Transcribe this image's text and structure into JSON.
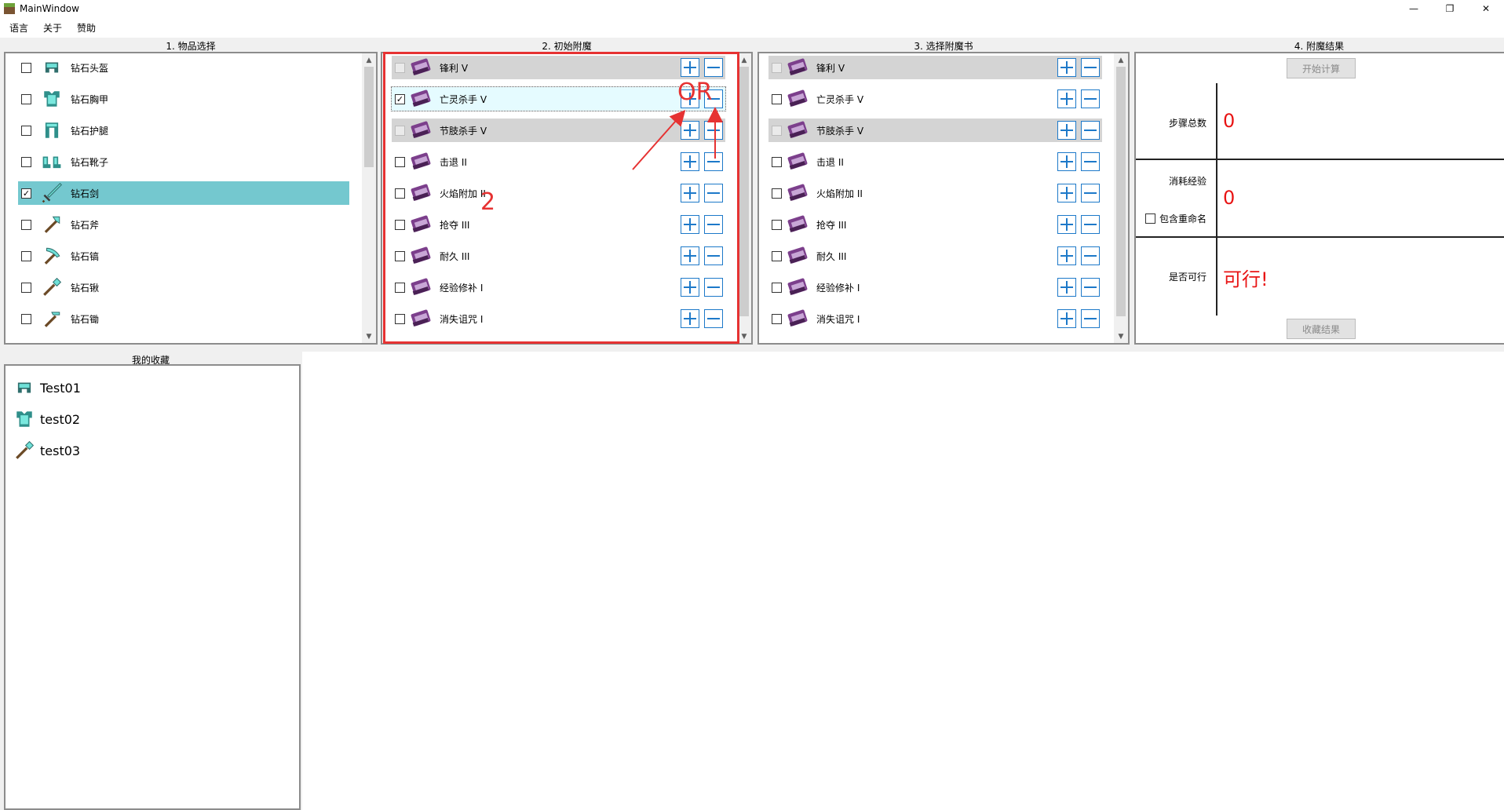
{
  "window": {
    "title": "MainWindow",
    "minimize": "—",
    "maximize": "❐",
    "close": "✕"
  },
  "menu": [
    "语言",
    "关于",
    "赞助"
  ],
  "groups": {
    "items": "1. 物品选择",
    "initial": "2. 初始附魔",
    "books": "3. 选择附魔书",
    "result": "4. 附魔结果"
  },
  "items": [
    {
      "label": "钻石头盔",
      "icon": "helmet-icon",
      "checked": false,
      "selected": false
    },
    {
      "label": "钻石胸甲",
      "icon": "chestplate-icon",
      "checked": false,
      "selected": false
    },
    {
      "label": "钻石护腿",
      "icon": "leggings-icon",
      "checked": false,
      "selected": false
    },
    {
      "label": "钻石靴子",
      "icon": "boots-icon",
      "checked": false,
      "selected": false
    },
    {
      "label": "钻石剑",
      "icon": "sword-icon",
      "checked": true,
      "selected": true
    },
    {
      "label": "钻石斧",
      "icon": "axe-icon",
      "checked": false,
      "selected": false
    },
    {
      "label": "钻石镐",
      "icon": "pickaxe-icon",
      "checked": false,
      "selected": false
    },
    {
      "label": "钻石锹",
      "icon": "shovel-icon",
      "checked": false,
      "selected": false
    },
    {
      "label": "钻石锄",
      "icon": "hoe-icon",
      "checked": false,
      "selected": false
    }
  ],
  "enchants_initial": [
    {
      "label": "锋利 V",
      "checked": false,
      "disabled": true,
      "state": "shaded"
    },
    {
      "label": "亡灵杀手 V",
      "checked": true,
      "disabled": false,
      "state": "focus"
    },
    {
      "label": "节肢杀手 V",
      "checked": false,
      "disabled": true,
      "state": "shaded"
    },
    {
      "label": "击退 II",
      "checked": false,
      "disabled": false,
      "state": ""
    },
    {
      "label": "火焰附加 II",
      "checked": false,
      "disabled": false,
      "state": ""
    },
    {
      "label": "抢夺 III",
      "checked": false,
      "disabled": false,
      "state": ""
    },
    {
      "label": "耐久 III",
      "checked": false,
      "disabled": false,
      "state": ""
    },
    {
      "label": "经验修补 I",
      "checked": false,
      "disabled": false,
      "state": ""
    },
    {
      "label": "消失诅咒 I",
      "checked": false,
      "disabled": false,
      "state": ""
    }
  ],
  "enchants_books": [
    {
      "label": "锋利 V",
      "checked": false,
      "disabled": true,
      "state": "shaded"
    },
    {
      "label": "亡灵杀手 V",
      "checked": false,
      "disabled": false,
      "state": ""
    },
    {
      "label": "节肢杀手 V",
      "checked": false,
      "disabled": true,
      "state": "shaded"
    },
    {
      "label": "击退 II",
      "checked": false,
      "disabled": false,
      "state": ""
    },
    {
      "label": "火焰附加 II",
      "checked": false,
      "disabled": false,
      "state": ""
    },
    {
      "label": "抢夺 III",
      "checked": false,
      "disabled": false,
      "state": ""
    },
    {
      "label": "耐久 III",
      "checked": false,
      "disabled": false,
      "state": ""
    },
    {
      "label": "经验修补 I",
      "checked": false,
      "disabled": false,
      "state": ""
    },
    {
      "label": "消失诅咒 I",
      "checked": false,
      "disabled": false,
      "state": ""
    }
  ],
  "result": {
    "start_button": "开始计算",
    "steps_label": "步骤总数",
    "steps_value": "0",
    "xp_label": "消耗经验",
    "xp_value": "0",
    "rename_label": "包含重命名",
    "feasible_label": "是否可行",
    "feasible_value": "可行!",
    "save_button": "收藏结果"
  },
  "favorites": {
    "title": "我的收藏",
    "items": [
      {
        "label": "Test01",
        "icon": "helmet-icon"
      },
      {
        "label": "test02",
        "icon": "chestplate-icon"
      },
      {
        "label": "test03",
        "icon": "shovel-icon"
      }
    ]
  },
  "annotations": {
    "or": "OR",
    "num": "2"
  },
  "colors": {
    "accent": "#1d79c9",
    "selected": "#74c8cf",
    "result_red": "#e81414",
    "annotation": "#e63232"
  }
}
